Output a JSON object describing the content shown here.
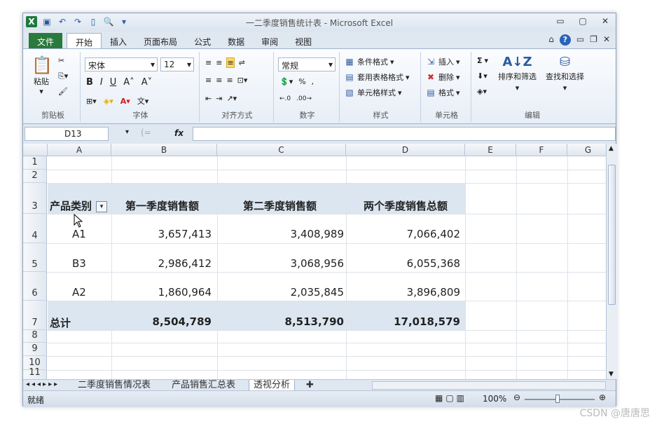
{
  "window": {
    "title": "一二季度销售统计表 - Microsoft Excel",
    "controls": {
      "minimize": "▭",
      "restore": "▢",
      "close": "✕"
    }
  },
  "qat": {
    "icons": [
      "excel-icon",
      "save-icon",
      "undo-icon",
      "redo-icon",
      "new-icon",
      "print-preview-icon",
      "customize-icon"
    ]
  },
  "tabs": [
    {
      "label": "文件"
    },
    {
      "label": "开始"
    },
    {
      "label": "插入"
    },
    {
      "label": "页面布局"
    },
    {
      "label": "公式"
    },
    {
      "label": "数据"
    },
    {
      "label": "审阅"
    },
    {
      "label": "视图"
    }
  ],
  "ribbon": {
    "clipboard": {
      "paste": "粘贴",
      "label": "剪贴板"
    },
    "font": {
      "name": "宋体",
      "size": "12",
      "label": "字体"
    },
    "alignment": {
      "label": "对齐方式"
    },
    "number": {
      "format": "常规",
      "percent": "%",
      "comma": ",",
      "label": "数字"
    },
    "styles": {
      "conditional": "条件格式",
      "table": "套用表格格式",
      "cell": "单元格样式",
      "label": "样式"
    },
    "cells": {
      "insert": "插入",
      "delete": "删除",
      "format": "格式",
      "label": "单元格"
    },
    "editing": {
      "sum": "Σ",
      "sort": "排序和筛选",
      "find": "查找和选择",
      "label": "编辑"
    }
  },
  "formula_bar": {
    "name_box": "D13",
    "fx": "fx",
    "value": ""
  },
  "columns": [
    "A",
    "B",
    "C",
    "D",
    "E",
    "F",
    "G"
  ],
  "rows": [
    "1",
    "2",
    "3",
    "4",
    "5",
    "6",
    "7",
    "8",
    "9",
    "10",
    "11"
  ],
  "table": {
    "headers": [
      "产品类别",
      "第一季度销售额",
      "第二季度销售额",
      "两个季度销售总额"
    ],
    "rows": [
      [
        "A1",
        "3,657,413",
        "3,408,989",
        "7,066,402"
      ],
      [
        "B3",
        "2,986,412",
        "3,068,956",
        "6,055,368"
      ],
      [
        "A2",
        "1,860,964",
        "2,035,845",
        "3,896,809"
      ]
    ],
    "total": [
      "总计",
      "8,504,789",
      "8,513,790",
      "17,018,579"
    ]
  },
  "sheet_tabs": [
    "二季度销售情况表",
    "产品销售汇总表",
    "透视分析"
  ],
  "status": {
    "ready": "就绪",
    "zoom": "100%"
  },
  "watermark": "CSDN @唐唐思",
  "colors": {
    "band": "#dce6f1",
    "file_tab": "#2a7a3d",
    "accent": "#2a63b8"
  }
}
